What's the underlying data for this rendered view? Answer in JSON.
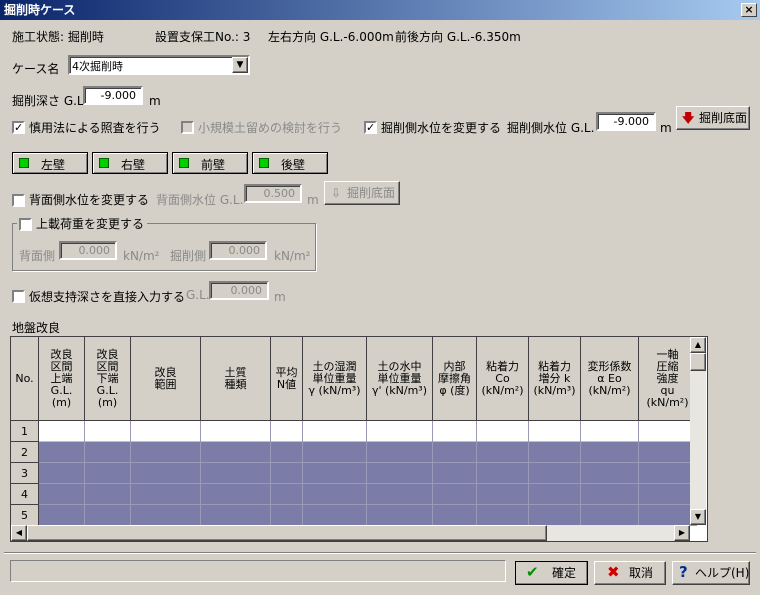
{
  "window": {
    "title": "掘削時ケース",
    "close": "×"
  },
  "info": {
    "status": "施工状態: 掘削時",
    "support": "設置支保工No.: 3",
    "lr": "左右方向 G.L.-6.000m",
    "fb": "前後方向 G.L.-6.350m"
  },
  "case": {
    "label": "ケース名",
    "value": "4次掘削時",
    "arrow": "▼"
  },
  "depth": {
    "label": "掘削深さ G.L.",
    "value": "-9.000",
    "unit": "m"
  },
  "options": {
    "prudent": {
      "label": "慎用法による照査を行う",
      "checked": true
    },
    "small": {
      "label": "小規模土留めの検討を行う",
      "checked": false
    },
    "water_change": {
      "label": "掘削側水位を変更する",
      "checked": true
    },
    "water_label": "掘削側水位 G.L.",
    "water_value": "-9.000",
    "water_unit": "m",
    "bottom_btn": "掘削底面"
  },
  "walls": [
    "左壁",
    "右壁",
    "前壁",
    "後壁"
  ],
  "back": {
    "label": "背面側水位を変更する",
    "level_label": "背面側水位 G.L.",
    "level_value": "0.500",
    "unit": "m",
    "bottom_btn": "掘削底面"
  },
  "load": {
    "label": "上載荷重を変更する",
    "back_label": "背面側",
    "back_value": "0.000",
    "back_unit": "kN/m²",
    "ex_label": "掘削側",
    "ex_value": "0.000",
    "ex_unit": "kN/m²"
  },
  "virtual": {
    "label": "仮想支持深さを直接入力する",
    "gl": "G.L.",
    "value": "0.000",
    "unit": "m"
  },
  "ground": {
    "label": "地盤改良",
    "columns": [
      "No.",
      "改良\n区間\n上端\nG.L.\n(m)",
      "改良\n区間\n下端\nG.L.\n(m)",
      "改良\n範囲",
      "土質\n種類",
      "平均\nN値",
      "土の湿潤\n単位重量\nγ (kN/m³)",
      "土の水中\n単位重量\nγ' (kN/m³)",
      "内部\n摩擦角\nφ (度)",
      "粘着力\nCo\n(kN/m²)",
      "粘着力\n増分 k\n(kN/m³)",
      "変形係数\nα Eo\n(kN/m²)",
      "一軸\n圧縮\n強度\nqu\n(kN/m²)"
    ],
    "rows": [
      "1",
      "2",
      "3",
      "4",
      "5"
    ]
  },
  "footer": {
    "ok": "確定",
    "cancel": "取消",
    "help": "ヘルプ(H)"
  },
  "colors": {
    "row_active": "#ffffff",
    "row_disabled": "#7c7ca8",
    "led": "#00d000"
  }
}
